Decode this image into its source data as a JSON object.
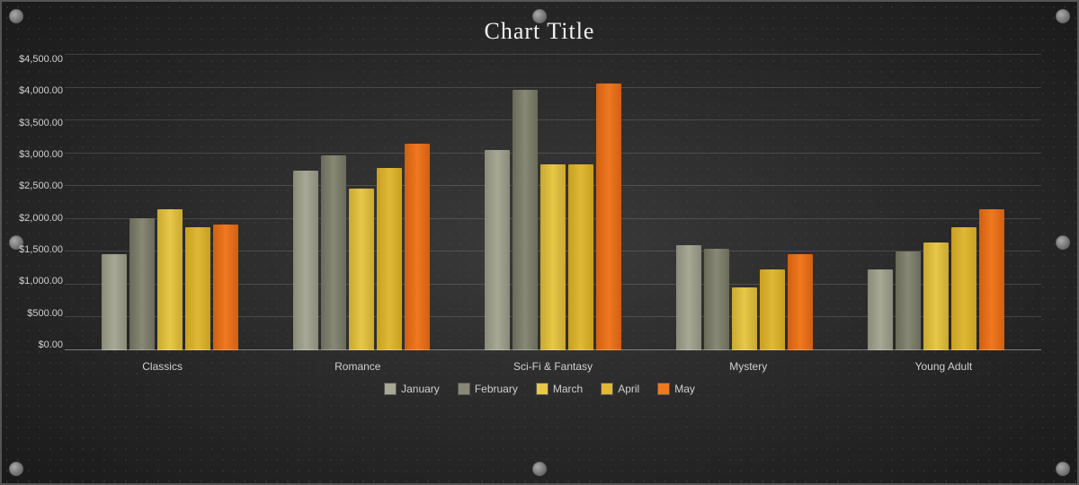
{
  "title": "Chart Title",
  "yAxis": {
    "labels": [
      "$4,500.00",
      "$4,000.00",
      "$3,500.00",
      "$3,000.00",
      "$2,500.00",
      "$2,000.00",
      "$1,500.00",
      "$1,000.00",
      "$500.00",
      "$0.00"
    ],
    "max": 4500
  },
  "categories": [
    "Classics",
    "Romance",
    "Sci-Fi & Fantasy",
    "Mystery",
    "Young Adult"
  ],
  "legend": [
    {
      "label": "January",
      "class": "january"
    },
    {
      "label": "February",
      "class": "february"
    },
    {
      "label": "March",
      "class": "march"
    },
    {
      "label": "April",
      "class": "april"
    },
    {
      "label": "May",
      "class": "may"
    }
  ],
  "series": {
    "january": [
      1600,
      3000,
      3350,
      1750,
      1350
    ],
    "february": [
      2200,
      3250,
      4350,
      1700,
      1650
    ],
    "march": [
      2350,
      2700,
      3100,
      1050,
      1800
    ],
    "april": [
      2050,
      3050,
      3100,
      1350,
      2050
    ],
    "may": [
      2100,
      3450,
      4450,
      1600,
      2350
    ]
  },
  "colors": {
    "background": "#2d2d2d",
    "accent": "#f07820"
  }
}
